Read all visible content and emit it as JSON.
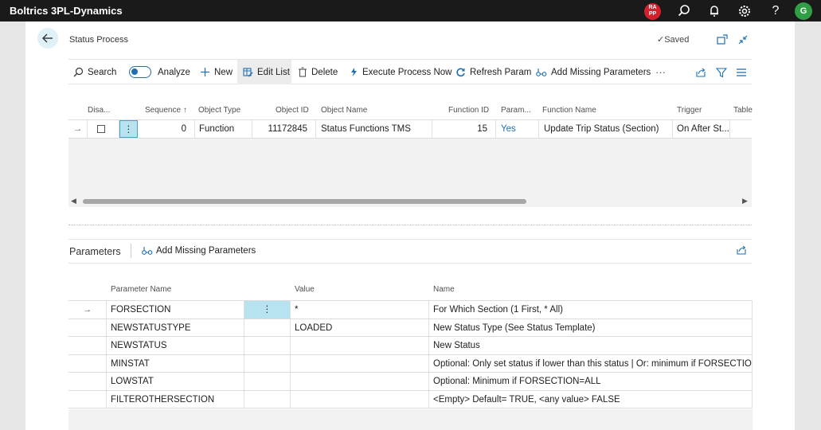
{
  "app": {
    "title": "Boltrics 3PL-Dynamics",
    "user_badge": "RA\nPP",
    "user_initial": "G"
  },
  "page": {
    "title": "Status Process",
    "status": "Saved"
  },
  "actions": {
    "search": "Search",
    "analyze": "Analyze",
    "new": "New",
    "edit_list": "Edit List",
    "delete": "Delete",
    "execute": "Execute Process Now",
    "refresh": "Refresh Param",
    "add_missing": "Add Missing Parameters",
    "more": "···"
  },
  "grid": {
    "columns": [
      "Disa...",
      "Sequence ↑",
      "Object Type",
      "Object ID",
      "Object Name",
      "Function ID",
      "Param...",
      "Function Name",
      "Trigger",
      "Table"
    ],
    "row": {
      "sequence": "0",
      "object_type": "Function",
      "object_id": "11172845",
      "object_name": "Status Functions TMS",
      "function_id": "15",
      "param": "Yes",
      "function_name": "Update Trip Status (Section)",
      "trigger": "On After St..."
    }
  },
  "parameters": {
    "title": "Parameters",
    "add_missing": "Add Missing Parameters",
    "columns": [
      "Parameter Name",
      "Value",
      "Name"
    ],
    "rows": [
      {
        "param": "FORSECTION",
        "value": "*",
        "name": "For Which Section (1 First, * All)"
      },
      {
        "param": "NEWSTATUSTYPE",
        "value": "LOADED",
        "name": "New Status Type (See Status Template)"
      },
      {
        "param": "NEWSTATUS",
        "value": "",
        "name": "New Status"
      },
      {
        "param": "MINSTAT",
        "value": "",
        "name": "Optional: Only set status if lower than this status | Or: minimum if FORSECTION..."
      },
      {
        "param": "LOWSTAT",
        "value": "",
        "name": "Optional: Minimum if FORSECTION=ALL"
      },
      {
        "param": "FILTEROTHERSECTION",
        "value": "",
        "name": "<Empty> Default= TRUE, <any value> FALSE"
      }
    ]
  },
  "colors": {
    "accent": "#1f6fb2",
    "selected_cell": "#b7e3f0",
    "topbar": "#1a1a1a",
    "badge_red": "#d3202c",
    "badge_green": "#2f9e44"
  }
}
